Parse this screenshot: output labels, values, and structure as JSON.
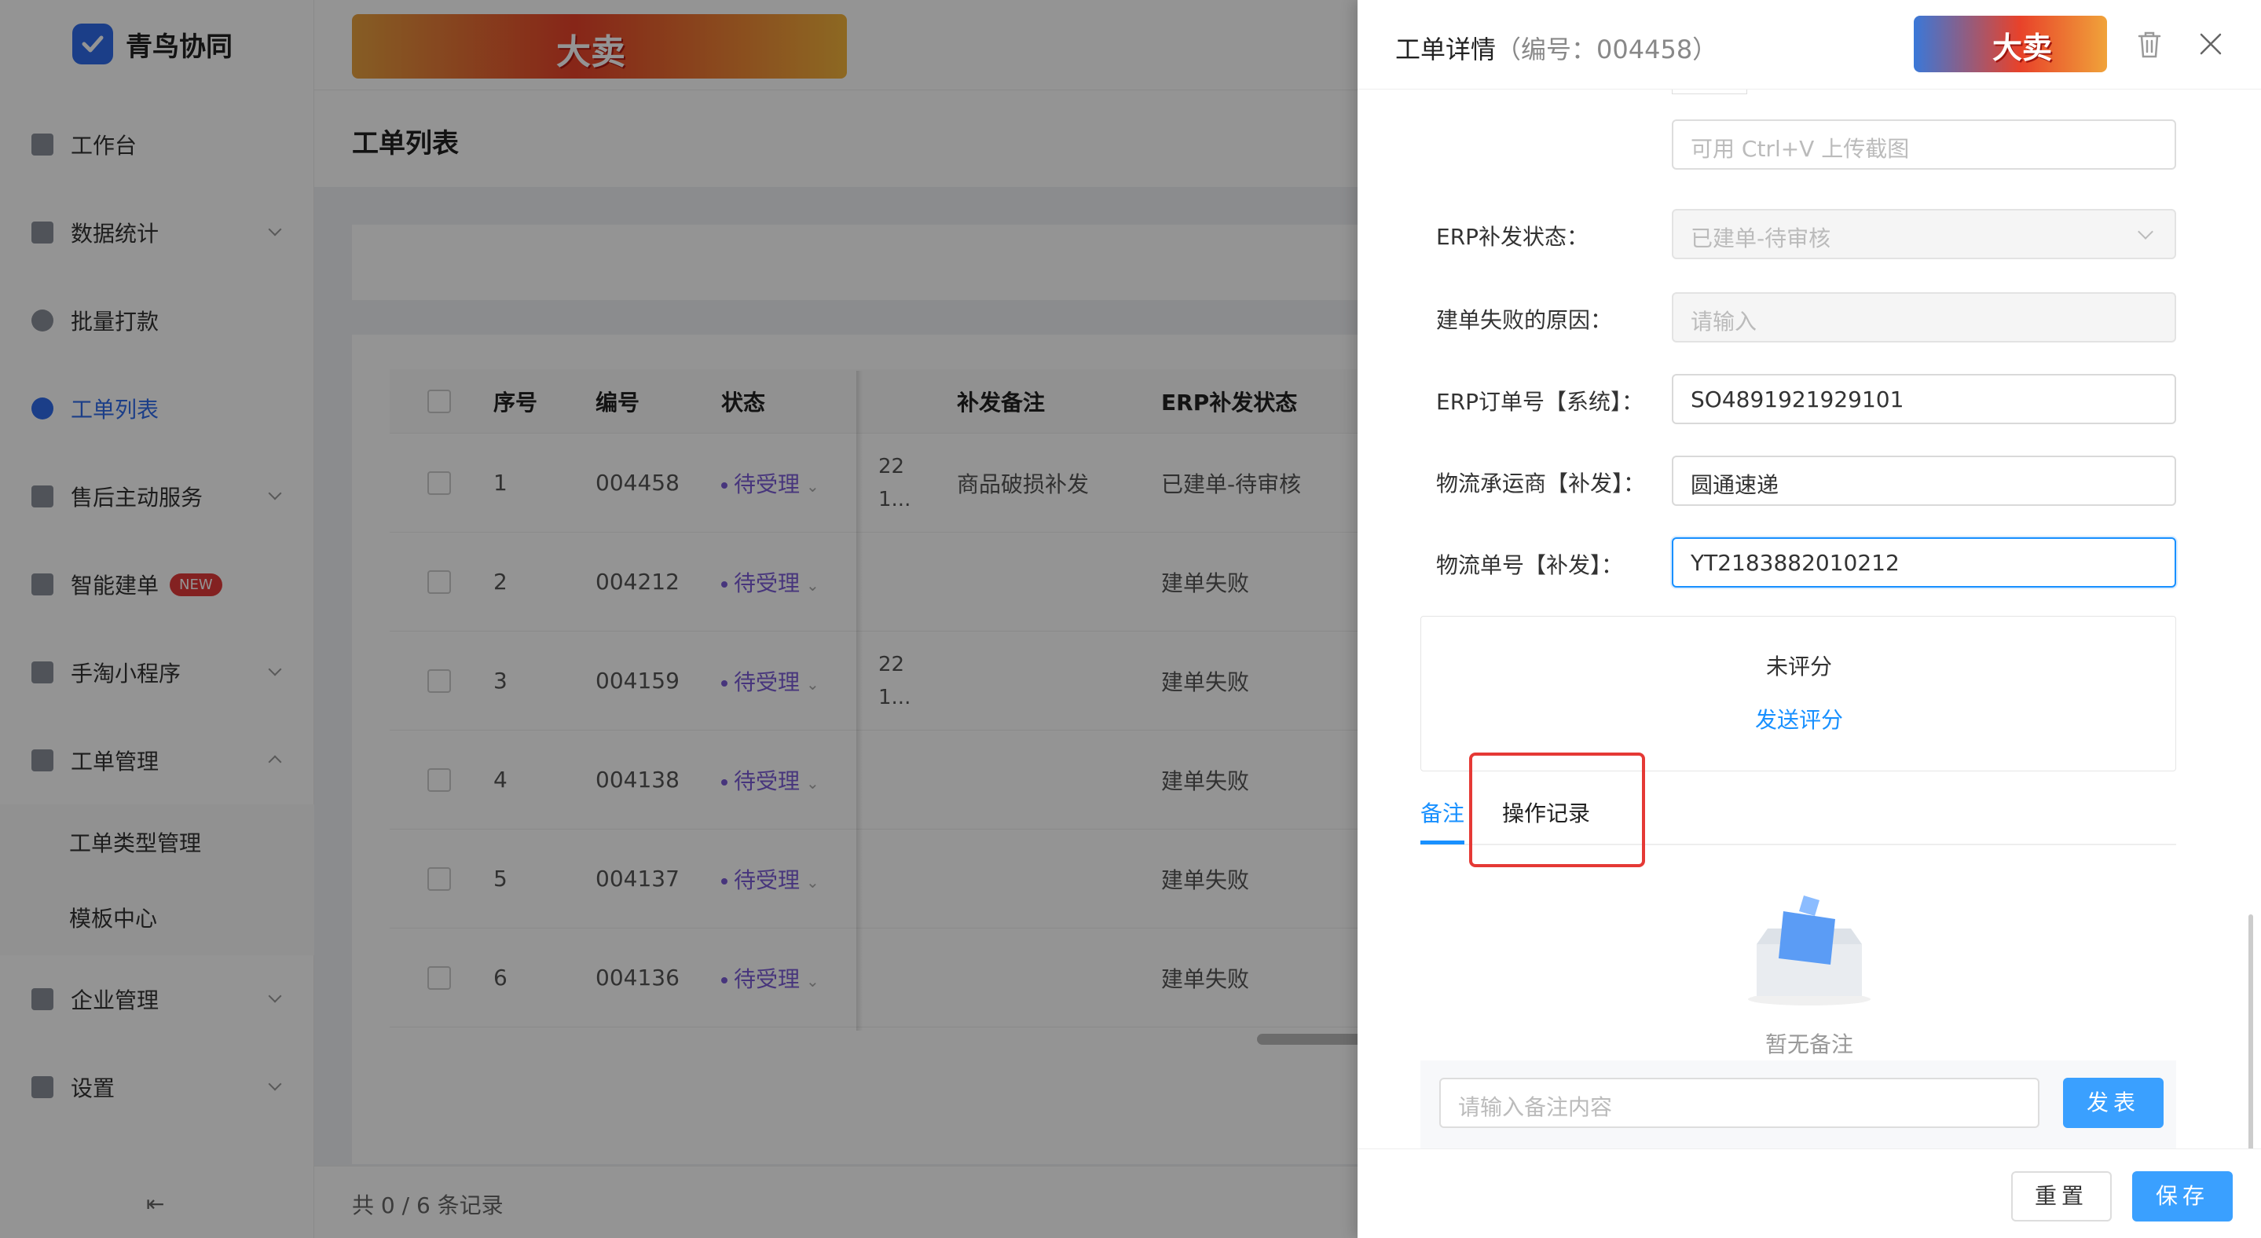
{
  "app": {
    "name": "青鸟协同",
    "brand_color": "#2f6bea"
  },
  "promo": {
    "text": "大卖"
  },
  "sidebar": {
    "items": [
      {
        "label": "工作台",
        "icon": "monitor-icon"
      },
      {
        "label": "数据统计",
        "icon": "bar-chart-icon"
      },
      {
        "label": "批量打款",
        "icon": "coin-icon"
      },
      {
        "label": "工单列表",
        "icon": "search-icon",
        "active": true
      },
      {
        "label": "售后主动服务",
        "icon": "chat-icon"
      },
      {
        "label": "智能建单",
        "icon": "document-icon",
        "badge": "NEW"
      },
      {
        "label": "手淘小程序",
        "icon": "clipboard-icon"
      },
      {
        "label": "工单管理",
        "icon": "folder-icon",
        "expanded": true
      }
    ],
    "sub_items": [
      {
        "label": "工单类型管理"
      },
      {
        "label": "模板中心"
      }
    ],
    "bottom_items": [
      {
        "label": "企业管理",
        "icon": "building-icon"
      },
      {
        "label": "设置",
        "icon": "settings-icon"
      }
    ]
  },
  "page": {
    "title": "工单列表"
  },
  "table": {
    "columns": [
      "序号",
      "编号",
      "状态",
      "补发备注",
      "ERP补发状态"
    ],
    "rows": [
      {
        "seq": "1",
        "no": "004458",
        "status": "待受理",
        "t1": "22",
        "t2": "1...",
        "note": "商品破损补发",
        "erp": "已建单-待审核"
      },
      {
        "seq": "2",
        "no": "004212",
        "status": "待受理",
        "t1": "",
        "t2": "",
        "note": "",
        "erp": "建单失败"
      },
      {
        "seq": "3",
        "no": "004159",
        "status": "待受理",
        "t1": "22",
        "t2": "1...",
        "note": "",
        "erp": "建单失败"
      },
      {
        "seq": "4",
        "no": "004138",
        "status": "待受理",
        "t1": "",
        "t2": "",
        "note": "",
        "erp": "建单失败"
      },
      {
        "seq": "5",
        "no": "004137",
        "status": "待受理",
        "t1": "",
        "t2": "",
        "note": "",
        "erp": "建单失败"
      },
      {
        "seq": "6",
        "no": "004136",
        "status": "待受理",
        "t1": "",
        "t2": "",
        "note": "",
        "erp": "建单失败"
      }
    ],
    "footer": "共 0 / 6 条记录"
  },
  "drawer": {
    "title": "工单详情",
    "subtitle": "（编号：004458）",
    "upload_hint": "可用 Ctrl+V 上传截图",
    "fields": [
      {
        "label": "ERP补发状态：",
        "value": "已建单-待审核"
      },
      {
        "label": "建单失败的原因：",
        "placeholder": "请输入"
      },
      {
        "label": "ERP订单号【系统】：",
        "value": "SO4891921929101"
      },
      {
        "label": "物流承运商【补发】：",
        "value": "圆通速递"
      },
      {
        "label": "物流单号【补发】：",
        "value": "YT2183882010212"
      }
    ],
    "rating": {
      "title": "未评分",
      "link": "发送评分"
    },
    "tabs": [
      {
        "label": "备注",
        "active": true
      },
      {
        "label": "操作记录"
      }
    ],
    "empty_text": "暂无备注",
    "comment_placeholder": "请输入备注内容",
    "send_label": "发表",
    "reset_label": "重置",
    "save_label": "保存",
    "accent": "#1890ff",
    "highlight_color": "#e53935"
  }
}
